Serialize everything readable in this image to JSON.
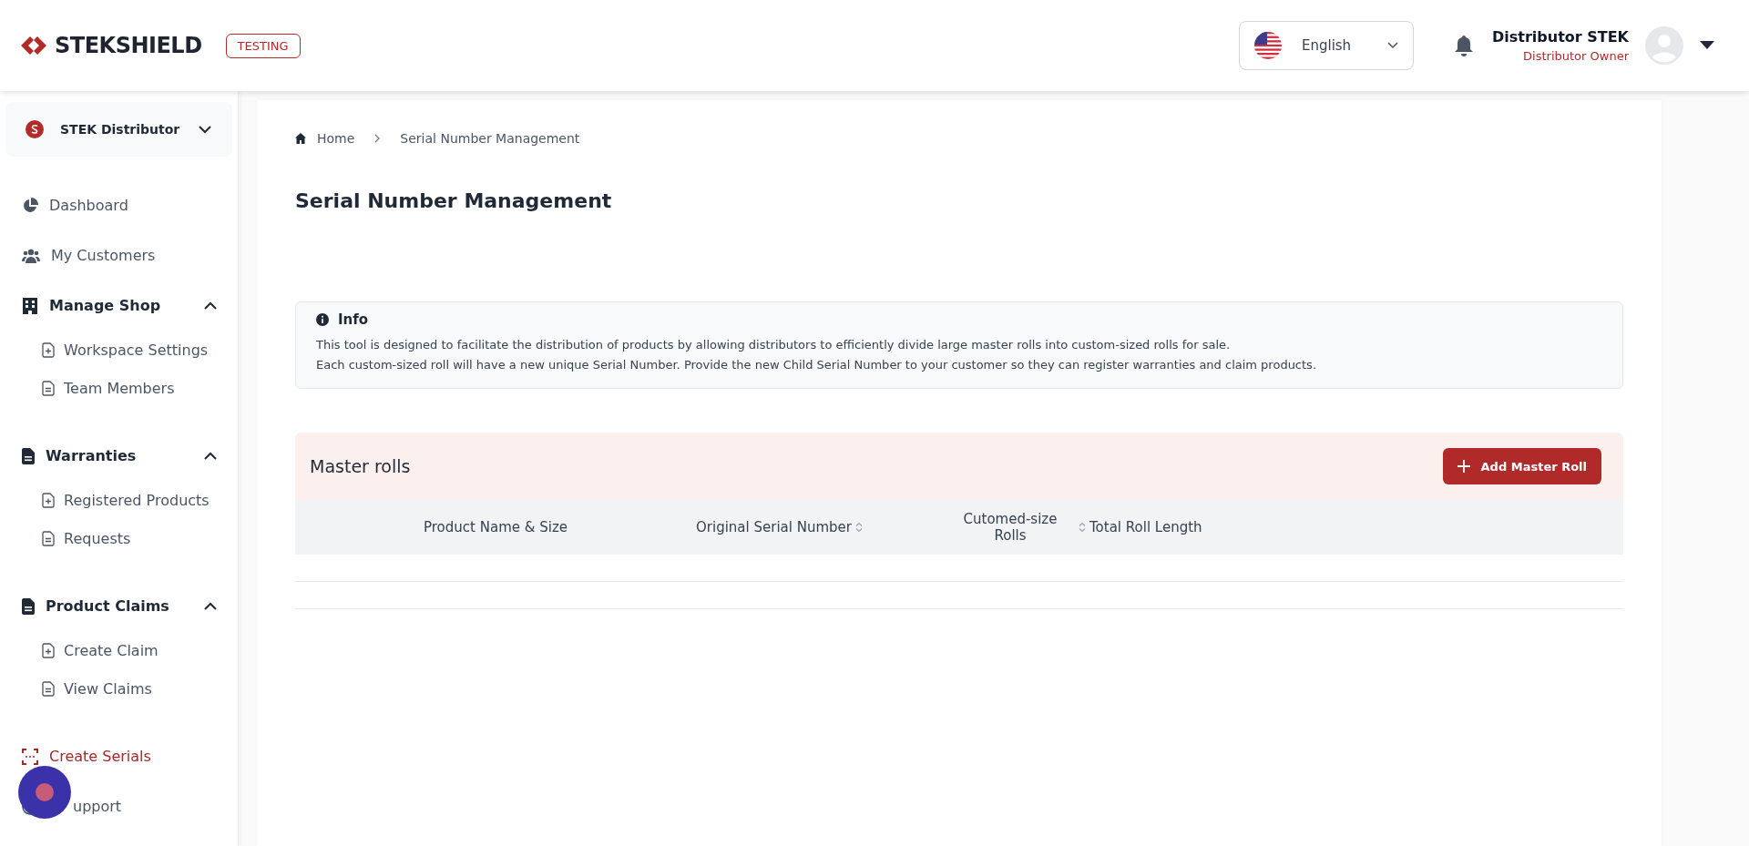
{
  "header": {
    "brand": "STEKSHIELD",
    "env_badge": "TESTING",
    "language": "English",
    "user": {
      "name": "Distributor STEK",
      "role": "Distributor Owner"
    }
  },
  "sidebar": {
    "workspace": "STEK Distributor",
    "items": [
      {
        "kind": "link",
        "label": "Dashboard",
        "selected": false
      },
      {
        "kind": "link",
        "label": "My Customers",
        "selected": false
      },
      {
        "kind": "section",
        "label": "Manage Shop",
        "expanded": true,
        "children": [
          {
            "label": "Workspace Settings",
            "selected": false
          },
          {
            "label": "Team Members",
            "selected": false
          }
        ]
      },
      {
        "kind": "section",
        "label": "Warranties",
        "expanded": true,
        "children": [
          {
            "label": "Registered Products",
            "selected": false
          },
          {
            "label": "Requests",
            "selected": false
          }
        ]
      },
      {
        "kind": "section",
        "label": "Product Claims",
        "expanded": true,
        "children": [
          {
            "label": "Create Claim",
            "selected": false
          },
          {
            "label": "View Claims",
            "selected": false
          }
        ]
      },
      {
        "kind": "link",
        "label": "Create Serials",
        "selected": true
      },
      {
        "kind": "link",
        "label": "upport",
        "selected": false
      }
    ]
  },
  "breadcrumb": [
    "Home",
    "Serial Number Management"
  ],
  "title": "Serial Number Management",
  "info": {
    "title": "Info",
    "lines": [
      "This tool is designed to facilitate the distribution of products by allowing distributors to efficiently divide large master rolls into custom-sized rolls for sale.",
      "Each custom-sized roll will have a new unique Serial Number. Provide the new Child Serial Number to your customer so they can register warranties and claim products."
    ]
  },
  "master_rolls": {
    "title": "Master rolls",
    "add_button": "Add Master Roll",
    "columns": [
      {
        "label": "Product Name & Size",
        "sortable": false
      },
      {
        "label": "Original Serial Number",
        "sortable": true
      },
      {
        "label": "Cutomed-size Rolls",
        "sortable": false
      },
      {
        "label": "Total Roll Length",
        "sortable": true
      }
    ]
  }
}
